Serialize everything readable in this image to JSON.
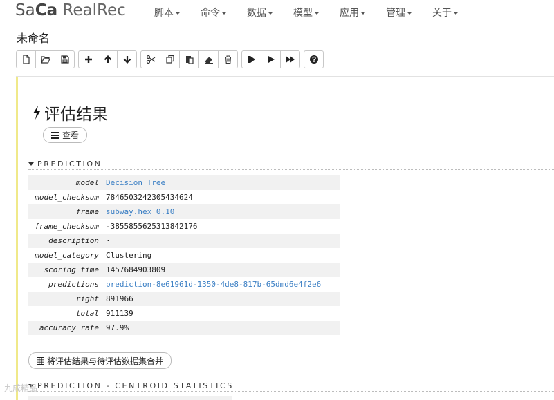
{
  "app": {
    "brand_sa": "Sa",
    "brand_cc": "Ca",
    "brand_rest": " RealRec"
  },
  "nav": {
    "items": [
      {
        "label": "脚本"
      },
      {
        "label": "命令"
      },
      {
        "label": "数据"
      },
      {
        "label": "模型"
      },
      {
        "label": "应用"
      },
      {
        "label": "管理"
      },
      {
        "label": "关于"
      }
    ]
  },
  "notebook": {
    "title": "未命名"
  },
  "toolbar": {
    "icons": [
      "new-file-icon",
      "open-folder-icon",
      "save-icon",
      "plus-icon",
      "arrow-up-icon",
      "arrow-down-icon",
      "scissors-icon",
      "copy-icon",
      "paste-icon",
      "eraser-icon",
      "trash-icon",
      "step-icon",
      "play-icon",
      "fast-forward-icon",
      "help-icon"
    ]
  },
  "output": {
    "title": "评估结果",
    "view_label": "查看",
    "section_prediction": "PREDICTION",
    "section_centroid": "PREDICTION - CENTROID STATISTICS",
    "merge_label": "将评估结果与待评估数据集合并",
    "rows": [
      {
        "key": "model",
        "value": "Decision Tree",
        "link": true
      },
      {
        "key": "model_checksum",
        "value": "7846503242305434624",
        "link": false
      },
      {
        "key": "frame",
        "value": "subway.hex_0.10",
        "link": true
      },
      {
        "key": "frame_checksum",
        "value": "-3855855625313842176",
        "link": false
      },
      {
        "key": "description",
        "value": "·",
        "link": false
      },
      {
        "key": "model_category",
        "value": "Clustering",
        "link": false
      },
      {
        "key": "scoring_time",
        "value": "1457684903809",
        "link": false
      },
      {
        "key": "predictions",
        "value": "prediction-8e61961d-1350-4de8-817b-65dmd6e4f2e6",
        "link": true
      },
      {
        "key": "right",
        "value": "891966",
        "link": false
      },
      {
        "key": "total",
        "value": "911139",
        "link": false
      },
      {
        "key": "accuracy rate",
        "value": "97.9%",
        "link": false
      }
    ]
  },
  "colors": {
    "cell_border": "#f0e98a",
    "link": "#3b7fc4"
  },
  "watermark": "九成精品"
}
